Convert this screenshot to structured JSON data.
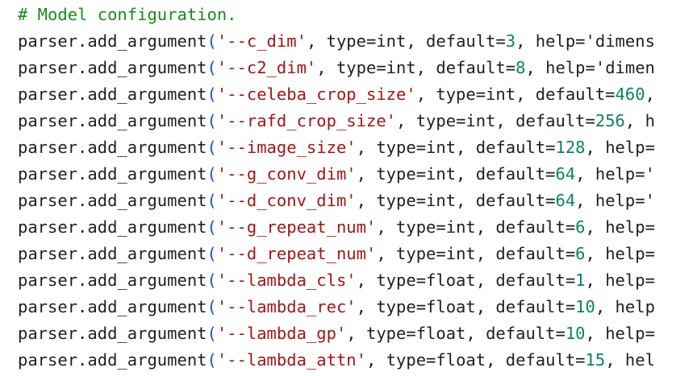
{
  "editor": {
    "comment": "# Model configuration.",
    "lines": [
      {
        "call": "parser.add_argument",
        "arg": "'--c_dim'",
        "type_part": ", type=int, default=",
        "default": "3",
        "rest": ", help='dimens"
      },
      {
        "call": "parser.add_argument",
        "arg": "'--c2_dim'",
        "type_part": ", type=int, default=",
        "default": "8",
        "rest": ", help='dimen"
      },
      {
        "call": "parser.add_argument",
        "arg": "'--celeba_crop_size'",
        "type_part": ", type=int, default=",
        "default": "460",
        "rest": ","
      },
      {
        "call": "parser.add_argument",
        "arg": "'--rafd_crop_size'",
        "type_part": ", type=int, default=",
        "default": "256",
        "rest": ", h"
      },
      {
        "call": "parser.add_argument",
        "arg": "'--image_size'",
        "type_part": ", type=int, default=",
        "default": "128",
        "rest": ", help="
      },
      {
        "call": "parser.add_argument",
        "arg": "'--g_conv_dim'",
        "type_part": ", type=int, default=",
        "default": "64",
        "rest": ", help='"
      },
      {
        "call": "parser.add_argument",
        "arg": "'--d_conv_dim'",
        "type_part": ", type=int, default=",
        "default": "64",
        "rest": ", help='"
      },
      {
        "call": "parser.add_argument",
        "arg": "'--g_repeat_num'",
        "type_part": ", type=int, default=",
        "default": "6",
        "rest": ", help="
      },
      {
        "call": "parser.add_argument",
        "arg": "'--d_repeat_num'",
        "type_part": ", type=int, default=",
        "default": "6",
        "rest": ", help="
      },
      {
        "call": "parser.add_argument",
        "arg": "'--lambda_cls'",
        "type_part": ", type=float, default=",
        "default": "1",
        "rest": ", help="
      },
      {
        "call": "parser.add_argument",
        "arg": "'--lambda_rec'",
        "type_part": ", type=float, default=",
        "default": "10",
        "rest": ", help"
      },
      {
        "call": "parser.add_argument",
        "arg": "'--lambda_gp'",
        "type_part": ", type=float, default=",
        "default": "10",
        "rest": ", help="
      },
      {
        "call": "parser.add_argument",
        "arg": "'--lambda_attn'",
        "type_part": ", type=float, default=",
        "default": "15",
        "rest": ", hel"
      }
    ]
  }
}
